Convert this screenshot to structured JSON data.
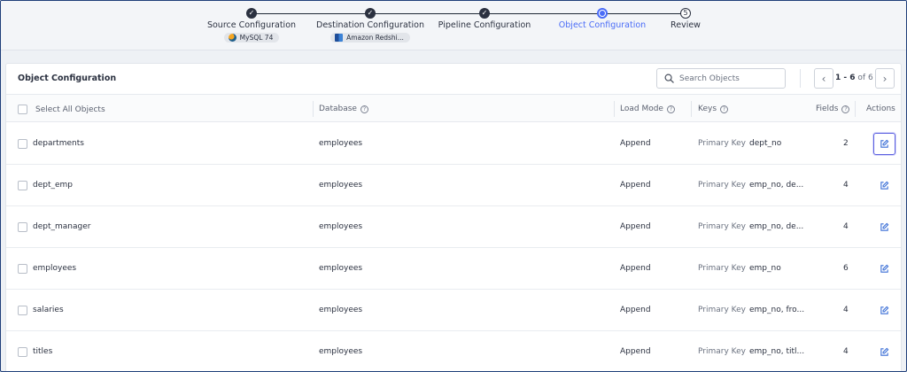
{
  "stepper": {
    "steps": [
      {
        "label": "Source Configuration",
        "state": "done",
        "chip": "MySQL 74",
        "chip_icon": "mysql-icon"
      },
      {
        "label": "Destination Configuration",
        "state": "done",
        "chip": "Amazon Redshi...",
        "chip_icon": "redshift-icon"
      },
      {
        "label": "Pipeline Configuration",
        "state": "done",
        "chip": ""
      },
      {
        "label": "Object Configuration",
        "state": "active",
        "chip": ""
      },
      {
        "label": "Review",
        "state": "todo",
        "number": "5",
        "chip": ""
      }
    ]
  },
  "card": {
    "title": "Object Configuration",
    "search_placeholder": "Search Objects",
    "pager": {
      "range": "1 - 6",
      "of": "of 6"
    }
  },
  "table": {
    "headers": {
      "select_all": "Select All Objects",
      "database": "Database",
      "load_mode": "Load Mode",
      "keys": "Keys",
      "fields": "Fields",
      "actions": "Actions"
    },
    "key_label": "Primary Key",
    "rows": [
      {
        "name": "departments",
        "database": "employees",
        "load_mode": "Append",
        "keys": "dept_no",
        "fields": "2"
      },
      {
        "name": "dept_emp",
        "database": "employees",
        "load_mode": "Append",
        "keys": "emp_no, de...",
        "fields": "4"
      },
      {
        "name": "dept_manager",
        "database": "employees",
        "load_mode": "Append",
        "keys": "emp_no, de...",
        "fields": "4"
      },
      {
        "name": "employees",
        "database": "employees",
        "load_mode": "Append",
        "keys": "emp_no",
        "fields": "6"
      },
      {
        "name": "salaries",
        "database": "employees",
        "load_mode": "Append",
        "keys": "emp_no, fro...",
        "fields": "4"
      },
      {
        "name": "titles",
        "database": "employees",
        "load_mode": "Append",
        "keys": "emp_no, titl...",
        "fields": "4"
      }
    ]
  },
  "colors": {
    "accent": "#4a6cf7",
    "dark": "#2b3140",
    "edit_icon": "#3b6fd6"
  }
}
